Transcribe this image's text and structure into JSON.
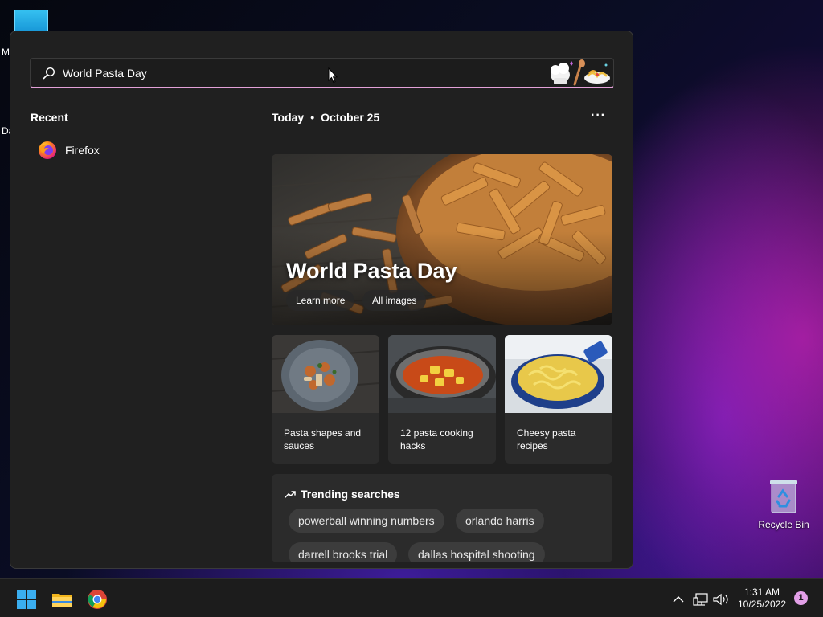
{
  "desktop": {
    "left_letters": [
      "M",
      "Da"
    ],
    "recycle_bin_label": "Recycle Bin"
  },
  "search": {
    "value": "World Pasta Day",
    "placeholder": "",
    "doodle_icon": "pasta-chef-doodle"
  },
  "recent": {
    "title": "Recent",
    "items": [
      {
        "label": "Firefox",
        "icon": "firefox-icon"
      }
    ]
  },
  "today": {
    "label": "Today",
    "separator": "•",
    "date": "October 25",
    "more_icon": "···"
  },
  "hero": {
    "title": "World Pasta Day",
    "buttons": [
      "Learn more",
      "All images"
    ]
  },
  "cards": [
    {
      "label": "Pasta shapes and sauces"
    },
    {
      "label": "12 pasta cooking hacks"
    },
    {
      "label": "Cheesy pasta recipes"
    }
  ],
  "trending": {
    "title": "Trending searches",
    "pills": [
      "powerball winning numbers",
      "orlando harris",
      "darrell brooks trial",
      "dallas hospital shooting"
    ]
  },
  "taskbar": {
    "apps": [
      "windows-start-icon",
      "file-explorer-icon",
      "chrome-icon"
    ],
    "time": "1:31 AM",
    "date": "10/25/2022",
    "notification_count": "1"
  },
  "colors": {
    "accent": "#e3a0d8",
    "panel_bg": "#202020",
    "card_bg": "#2b2b2b"
  }
}
